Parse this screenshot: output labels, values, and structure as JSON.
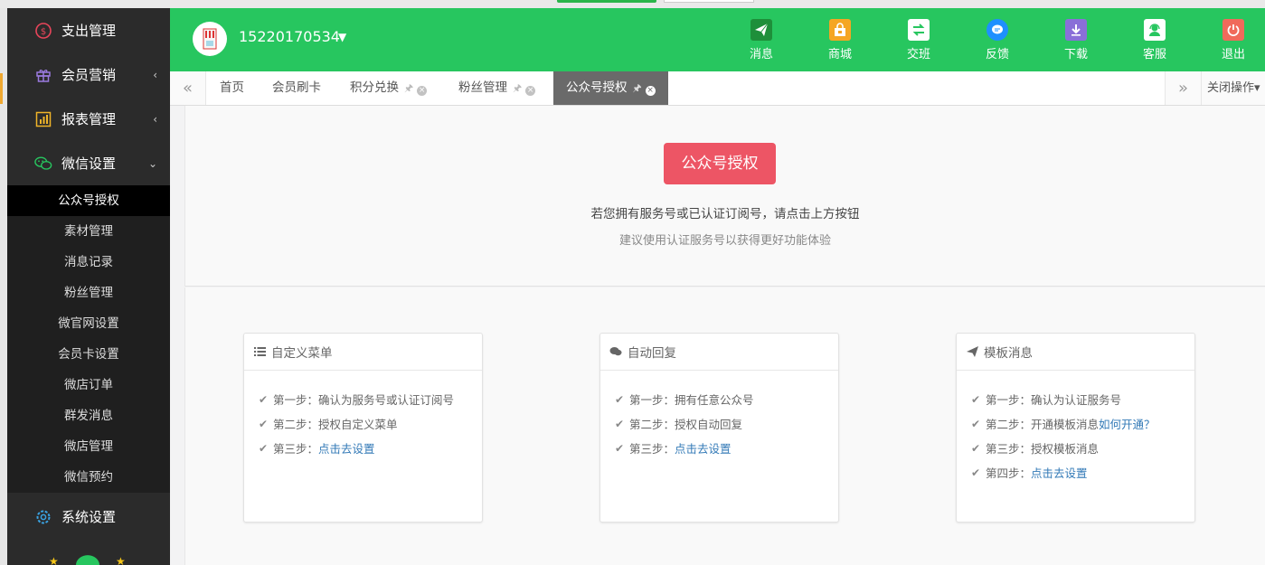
{
  "sidebar": {
    "items": [
      {
        "label": "支出管理",
        "icon": "money-circle-icon",
        "arrow": ""
      },
      {
        "label": "会员营销",
        "icon": "gift-icon",
        "arrow": "‹"
      },
      {
        "label": "报表管理",
        "icon": "chart-icon",
        "arrow": "‹"
      },
      {
        "label": "微信设置",
        "icon": "wechat-icon",
        "arrow": "⌄"
      }
    ],
    "submenu": [
      "公众号授权",
      "素材管理",
      "消息记录",
      "粉丝管理",
      "微官网设置",
      "会员卡设置",
      "微店订单",
      "群发消息",
      "微店管理",
      "微信预约"
    ],
    "bottom_item": {
      "label": "系统设置",
      "icon": "gear-icon"
    }
  },
  "header": {
    "phone": "15220170534",
    "buttons": [
      {
        "label": "消息",
        "icon": "paper-plane-icon",
        "color": "#1e8f3a"
      },
      {
        "label": "商城",
        "icon": "shop-icon",
        "color": "#f5a623"
      },
      {
        "label": "交班",
        "icon": "exchange-icon",
        "color": "#ffffff"
      },
      {
        "label": "反馈",
        "icon": "chat-bubble-icon",
        "color": "#1e90ff"
      },
      {
        "label": "下载",
        "icon": "download-icon",
        "color": "#8a6fd8"
      },
      {
        "label": "客服",
        "icon": "support-icon",
        "color": "#ffffff"
      },
      {
        "label": "退出",
        "icon": "power-icon",
        "color": "#f06a5b"
      }
    ]
  },
  "tabs": {
    "items": [
      {
        "label": "首页",
        "closable": false
      },
      {
        "label": "会员刷卡",
        "closable": false
      },
      {
        "label": "积分兑换",
        "closable": true
      },
      {
        "label": "粉丝管理",
        "closable": true
      },
      {
        "label": "公众号授权",
        "closable": true,
        "active": true
      }
    ],
    "close_ops": "关闭操作"
  },
  "auth": {
    "button": "公众号授权",
    "hint1": "若您拥有服务号或已认证订阅号，请点击上方按钮",
    "hint2": "建议使用认证服务号以获得更好功能体验"
  },
  "cards": [
    {
      "title": "自定义菜单",
      "icon": "list-icon",
      "steps": [
        {
          "text": "第一步：确认为服务号或认证订阅号",
          "link": ""
        },
        {
          "text": "第二步：授权自定义菜单",
          "link": ""
        },
        {
          "text": "第三步：",
          "link": "点击去设置"
        }
      ]
    },
    {
      "title": "自动回复",
      "icon": "comments-icon",
      "steps": [
        {
          "text": "第一步：拥有任意公众号",
          "link": ""
        },
        {
          "text": "第二步：授权自动回复",
          "link": ""
        },
        {
          "text": "第三步：",
          "link": "点击去设置"
        }
      ]
    },
    {
      "title": "模板消息",
      "icon": "send-icon",
      "steps": [
        {
          "text": "第一步：确认为认证服务号",
          "link": ""
        },
        {
          "text": "第二步：开通模板消息 ",
          "link": "如何开通？"
        },
        {
          "text": "第三步：授权模板消息",
          "link": ""
        },
        {
          "text": "第四步：",
          "link": "点击去设置"
        }
      ]
    }
  ]
}
